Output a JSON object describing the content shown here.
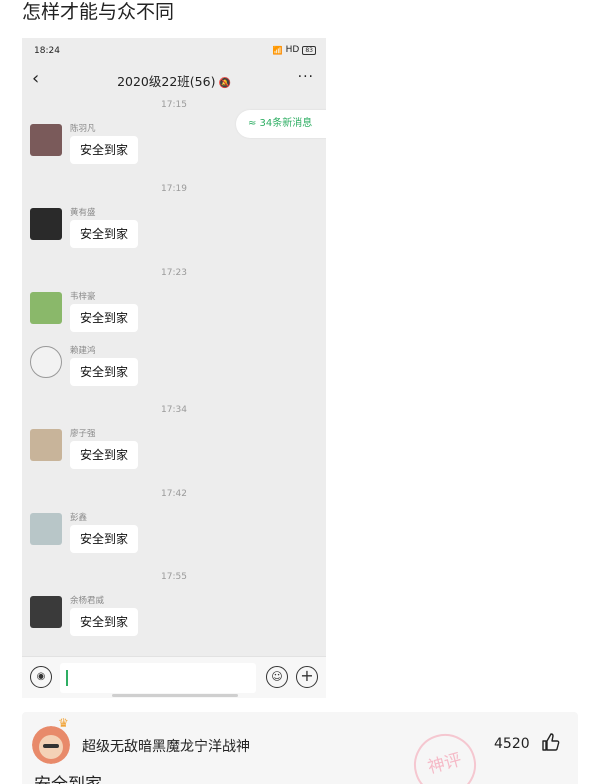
{
  "post": {
    "title": "怎样才能与众不同"
  },
  "status_bar": {
    "time": "18:24",
    "signal": "📶",
    "network": "HD",
    "battery": "83"
  },
  "chat": {
    "back": "‹",
    "title": "2020级22班(56)",
    "mute_icon": "🔕",
    "more": "···",
    "new_messages": "≈ 34条新消息",
    "messages": [
      {
        "time": "17:15",
        "sender": "陈羽凡",
        "text": "安全到家",
        "avatar_color": "#7a5a5a"
      },
      {
        "time": "17:19",
        "sender": "黄有盛",
        "text": "安全到家",
        "avatar_color": "#2a2a2a"
      },
      {
        "time": "17:23",
        "sender": "韦梓豪",
        "text": "安全到家",
        "avatar_color": "#8ab86a"
      },
      {
        "time": "",
        "sender": "赖建鸿",
        "text": "安全到家",
        "avatar_color": "#f2f2f2"
      },
      {
        "time": "17:34",
        "sender": "廖子强",
        "text": "安全到家",
        "avatar_color": "#c8b49a"
      },
      {
        "time": "17:42",
        "sender": "彭鑫",
        "text": "安全到家",
        "avatar_color": "#b8c6c8"
      },
      {
        "time": "17:55",
        "sender": "余杨君威",
        "text": "安全到家",
        "avatar_color": "#3a3a3a"
      }
    ]
  },
  "input_bar": {
    "voice": "◉",
    "emoji": "☺",
    "plus": "+"
  },
  "comment": {
    "username": "超级无敌暗黑魔龙宁洋战神",
    "likes": "4520",
    "stamp": "神评",
    "text": "安全到家",
    "accent": "#f1a336"
  }
}
